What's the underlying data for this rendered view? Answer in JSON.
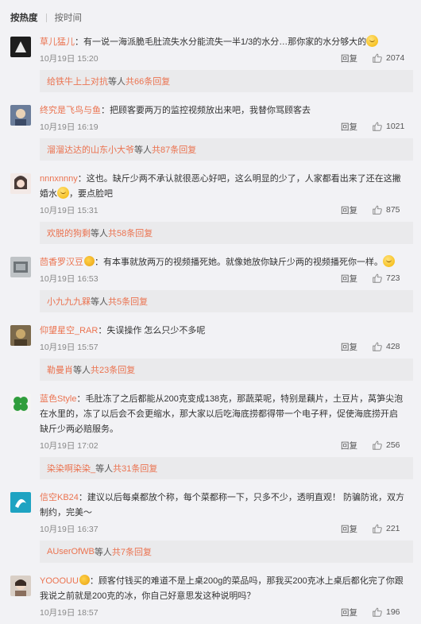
{
  "sort": {
    "hot": "按热度",
    "time": "按时间"
  },
  "reply_label": "回复",
  "comments": [
    {
      "user": "草儿猛儿",
      "text": "：有一说一海派脆毛肚流失水分能流失一半1/3的水分…那你家的水分够大的",
      "emoji": true,
      "time": "10月19日 15:20",
      "likes": "2074",
      "reply_user": "给铁牛上上对抗",
      "reply_mid": " 等人 ",
      "reply_count": "共66条回复"
    },
    {
      "user": "终究是飞鸟与鱼",
      "text": "：把顾客要两万的监控视频放出来吧，我替你骂顾客去",
      "time": "10月19日 16:19",
      "likes": "1021",
      "reply_user": "溜溜达达的山东小大爷",
      "reply_mid": " 等人 ",
      "reply_count": "共87条回复"
    },
    {
      "user": "nnnxnnny",
      "text": "：这也。缺斤少两不承认就很恶心好吧，这么明显的少了，人家都看出来了还在这撇婚水",
      "text2": "，要点脸吧",
      "emoji": true,
      "time": "10月19日 15:31",
      "likes": "875",
      "reply_user": "欢脱的狗剩",
      "reply_mid": " 等人 ",
      "reply_count": "共58条回复"
    },
    {
      "user": "茴香罗汉豆",
      "medal": true,
      "text": "：有本事就放两万的视频播死她。就像她放你缺斤少两的视频播死你一样。",
      "emoji": true,
      "time": "10月19日 16:53",
      "likes": "723",
      "reply_user": "小九九九槑",
      "reply_mid": " 等人 ",
      "reply_count": "共5条回复"
    },
    {
      "user": "仰望星空_RAR",
      "text": "：失误操作 怎么只少不多呢",
      "time": "10月19日 15:57",
      "likes": "428",
      "reply_user": "勒曼肖",
      "reply_mid": " 等人 ",
      "reply_count": "共23条回复"
    },
    {
      "user": "蓝色Style",
      "text": "：毛肚冻了之后都能从200克变成138克，那蔬菜呢，特别是藕片，土豆片，莴笋尖泡在水里的，冻了以后会不会更缩水，那大家以后吃海底捞都得带一个电子秤，促使海底捞开启缺斤少两必赔服务。",
      "time": "10月19日 17:02",
      "likes": "256",
      "reply_user": "染染啊染染_",
      "reply_mid": " 等人 ",
      "reply_count": "共31条回复"
    },
    {
      "user": "信空KB24",
      "text": "：建议以后每桌都放个称，每个菜都称一下，只多不少，透明直观！ 防骗防讹，双方制约，完美～",
      "time": "10月19日 16:37",
      "likes": "221",
      "reply_user": "AUserOfWB",
      "reply_mid": " 等人 ",
      "reply_count": "共7条回复"
    },
    {
      "user": "YOOOUU",
      "medal": true,
      "text": "：顾客付钱买的难道不是上桌200g的菜品吗，那我买200克冰上桌后都化完了你跟我说之前就是200克的冰，你自己好意思发这种说明吗？",
      "time": "10月19日 18:57",
      "likes": "196"
    }
  ],
  "colors": {
    "username": "#eb7350",
    "background": "#f2f2f5",
    "reply_box": "#eaeaec"
  }
}
